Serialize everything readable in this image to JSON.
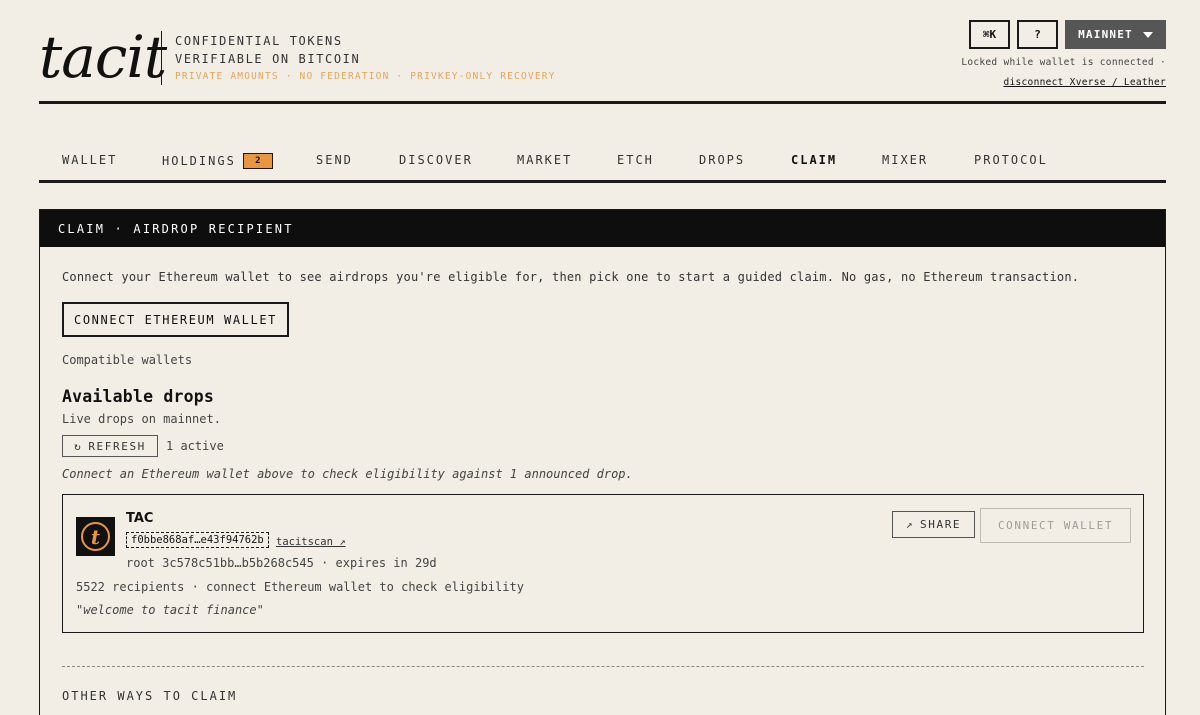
{
  "header": {
    "logo": "tacit",
    "tagline_line1": "CONFIDENTIAL TOKENS",
    "tagline_line2": "VERIFIABLE ON BITCOIN",
    "tagline_sub": "PRIVATE AMOUNTS · NO FEDERATION · PRIVKEY-ONLY RECOVERY",
    "shortcut_label": "⌘K",
    "help_label": "?",
    "network_label": "MAINNET",
    "lock_note": "Locked while wallet is connected ·",
    "disconnect_label": "disconnect Xverse / Leather"
  },
  "nav": {
    "items": [
      {
        "label": "WALLET"
      },
      {
        "label": "HOLDINGS",
        "badge": "2"
      },
      {
        "label": "SEND"
      },
      {
        "label": "DISCOVER"
      },
      {
        "label": "MARKET"
      },
      {
        "label": "ETCH"
      },
      {
        "label": "DROPS"
      },
      {
        "label": "CLAIM",
        "active": true
      },
      {
        "label": "MIXER"
      },
      {
        "label": "PROTOCOL"
      }
    ]
  },
  "claim": {
    "panel_title": "CLAIM · AIRDROP RECIPIENT",
    "intro": "Connect your Ethereum wallet to see airdrops you're eligible for, then pick one to start a guided claim. No gas, no Ethereum transaction.",
    "connect_button": "CONNECT ETHEREUM WALLET",
    "compatible_wallets": "Compatible wallets",
    "available_title": "Available drops",
    "available_sub": "Live drops on mainnet.",
    "refresh_icon": "↻",
    "refresh_label": "REFRESH",
    "active_count": "1 active",
    "eligibility_note": "Connect an Ethereum wallet above to check eligibility against 1 announced drop.",
    "other_ways": "OTHER WAYS TO CLAIM"
  },
  "drop": {
    "token_logo_letter": "t",
    "token_name": "TAC",
    "token_id": "f0bbe868af…e43f94762b",
    "scan_link": "tacitscan ↗",
    "root_line": "root 3c578c51bb…b5b268c545 · expires in 29d",
    "recipients_line": "5522 recipients · connect Ethereum wallet to check eligibility",
    "quote": "\"welcome to tacit finance\"",
    "share_icon": "↗",
    "share_label": "SHARE",
    "connect_wallet_label": "CONNECT WALLET"
  },
  "colors": {
    "background": "#f2eee6",
    "accent": "#e8963f",
    "panel_header": "#0e0e0e",
    "network_button": "#565656"
  }
}
